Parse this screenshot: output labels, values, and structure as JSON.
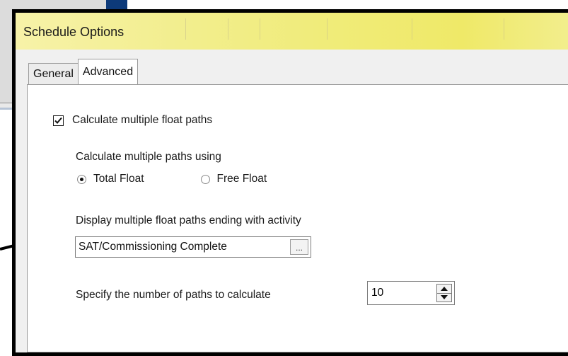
{
  "dialog": {
    "title": "Schedule Options",
    "tabs": [
      {
        "label": "General",
        "active": false
      },
      {
        "label": "Advanced",
        "active": true
      }
    ]
  },
  "advanced": {
    "calc_multiple": {
      "label": "Calculate multiple float paths",
      "checked": true
    },
    "paths_using": {
      "label": "Calculate multiple paths using",
      "options": [
        {
          "label": "Total Float",
          "selected": true
        },
        {
          "label": "Free Float",
          "selected": false
        }
      ]
    },
    "ending_activity": {
      "label": "Display multiple float paths ending with activity",
      "value": "SAT/Commissioning Complete",
      "browse_label": "..."
    },
    "num_paths": {
      "label": "Specify the number of paths to calculate",
      "value": "10"
    }
  },
  "colors": {
    "titlebar": "#f0ec7a",
    "frame": "#000000",
    "panel": "#ffffff"
  }
}
